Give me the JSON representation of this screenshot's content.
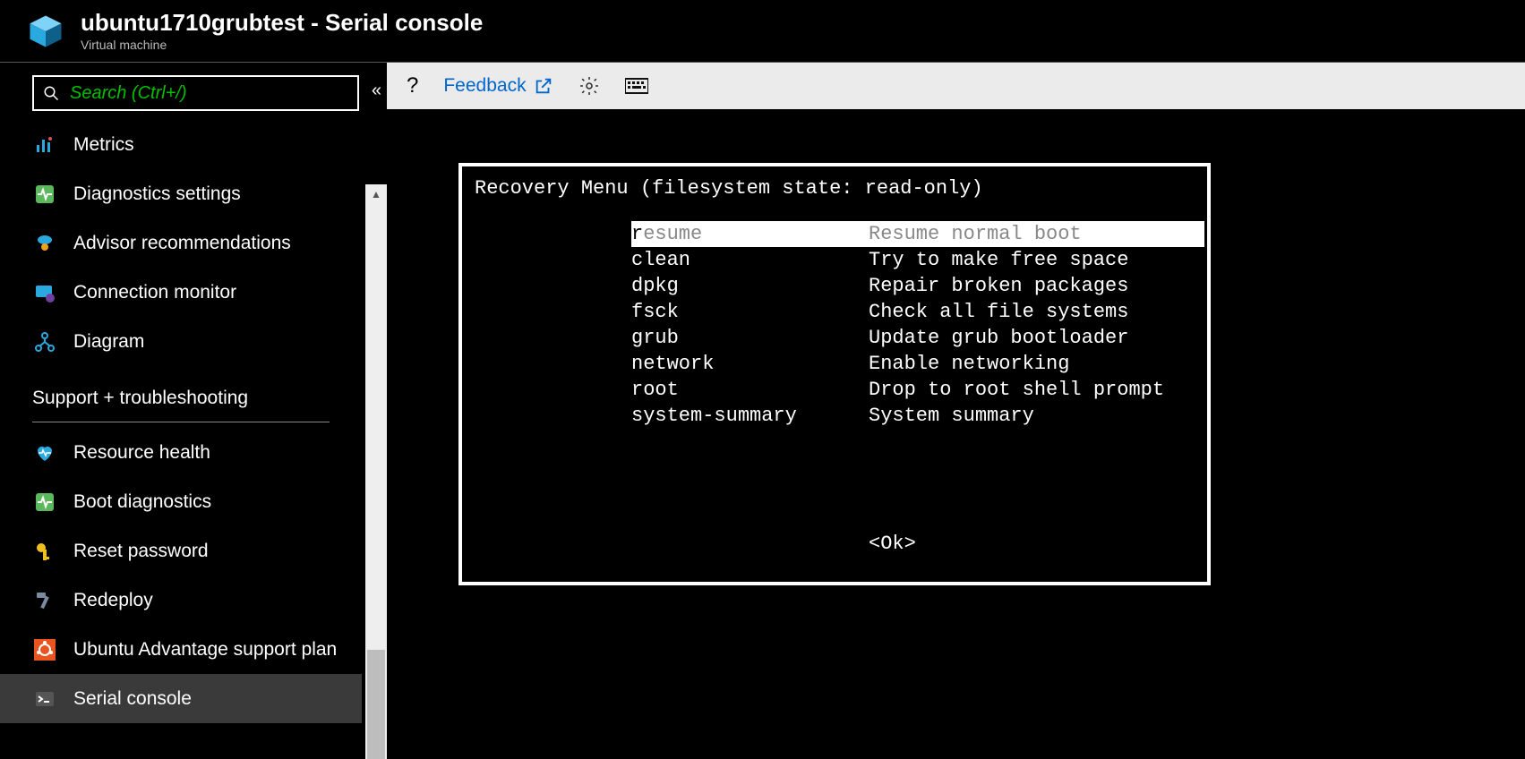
{
  "header": {
    "title": "ubuntu1710grubtest - Serial console",
    "subtitle": "Virtual machine"
  },
  "search": {
    "placeholder": "Search (Ctrl+/)"
  },
  "sidebar": {
    "items": [
      {
        "label": "Metrics",
        "icon": "metrics"
      },
      {
        "label": "Diagnostics settings",
        "icon": "diag"
      },
      {
        "label": "Advisor recommendations",
        "icon": "advisor"
      },
      {
        "label": "Connection monitor",
        "icon": "connmon"
      },
      {
        "label": "Diagram",
        "icon": "diagram"
      }
    ],
    "section_header": "Support + troubleshooting",
    "support_items": [
      {
        "label": "Resource health",
        "icon": "health"
      },
      {
        "label": "Boot diagnostics",
        "icon": "bootdiag"
      },
      {
        "label": "Reset password",
        "icon": "key"
      },
      {
        "label": "Redeploy",
        "icon": "hammer"
      },
      {
        "label": "Ubuntu Advantage support plan",
        "icon": "ubuntu"
      },
      {
        "label": "Serial console",
        "icon": "console",
        "selected": true
      }
    ]
  },
  "toolbar": {
    "help": "?",
    "feedback": "Feedback"
  },
  "terminal": {
    "title": "Recovery Menu (filesystem state: read-only)",
    "menu": [
      {
        "key": "resume",
        "desc": "Resume normal boot",
        "selected": true
      },
      {
        "key": "clean",
        "desc": "Try to make free space"
      },
      {
        "key": "dpkg",
        "desc": "Repair broken packages"
      },
      {
        "key": "fsck",
        "desc": "Check all file systems"
      },
      {
        "key": "grub",
        "desc": "Update grub bootloader"
      },
      {
        "key": "network",
        "desc": "Enable networking"
      },
      {
        "key": "root",
        "desc": "Drop to root shell prompt"
      },
      {
        "key": "system-summary",
        "desc": "System summary"
      }
    ],
    "ok": "<Ok>"
  }
}
